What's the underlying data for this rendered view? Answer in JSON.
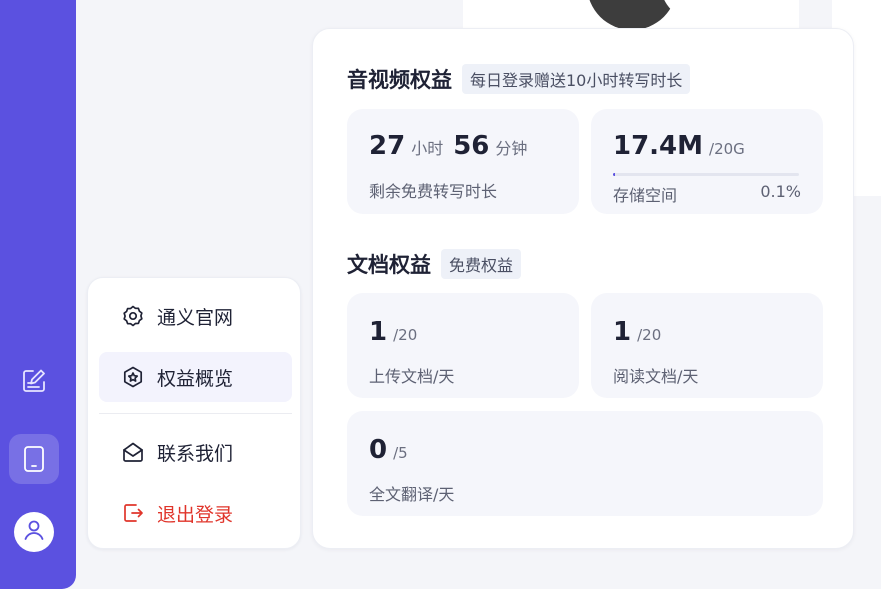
{
  "sidebar": {
    "buttons": [
      {
        "icon": "edit-note-icon"
      },
      {
        "icon": "tablet-icon"
      }
    ],
    "avatar_icon": "user-icon",
    "accent_color": "#5b51e0"
  },
  "menu": {
    "items": [
      {
        "label": "通义官网",
        "icon": "gear-badge-icon",
        "active": false
      },
      {
        "label": "权益概览",
        "icon": "star-badge-icon",
        "active": true
      },
      {
        "label": "联系我们",
        "icon": "mail-open-icon",
        "active": false
      },
      {
        "label": "退出登录",
        "icon": "logout-icon",
        "active": false,
        "color": "#e0352b"
      }
    ]
  },
  "benefits": {
    "av": {
      "title": "音视频权益",
      "tag": "每日登录赠送10小时转写时长",
      "remaining": {
        "hours": "27",
        "hours_unit": "小时",
        "minutes": "56",
        "minutes_unit": "分钟",
        "label": "剩余免费转写时长"
      },
      "storage": {
        "used": "17.4M",
        "total": "/20G",
        "label": "存储空间",
        "percent": "0.1%",
        "fill_fraction": 0.001
      }
    },
    "doc": {
      "title": "文档权益",
      "tag": "免费权益",
      "upload": {
        "value": "1",
        "limit": "/20",
        "label": "上传文档/天"
      },
      "read": {
        "value": "1",
        "limit": "/20",
        "label": "阅读文档/天"
      },
      "translate": {
        "value": "0",
        "limit": "/5",
        "label": "全文翻译/天"
      }
    }
  }
}
